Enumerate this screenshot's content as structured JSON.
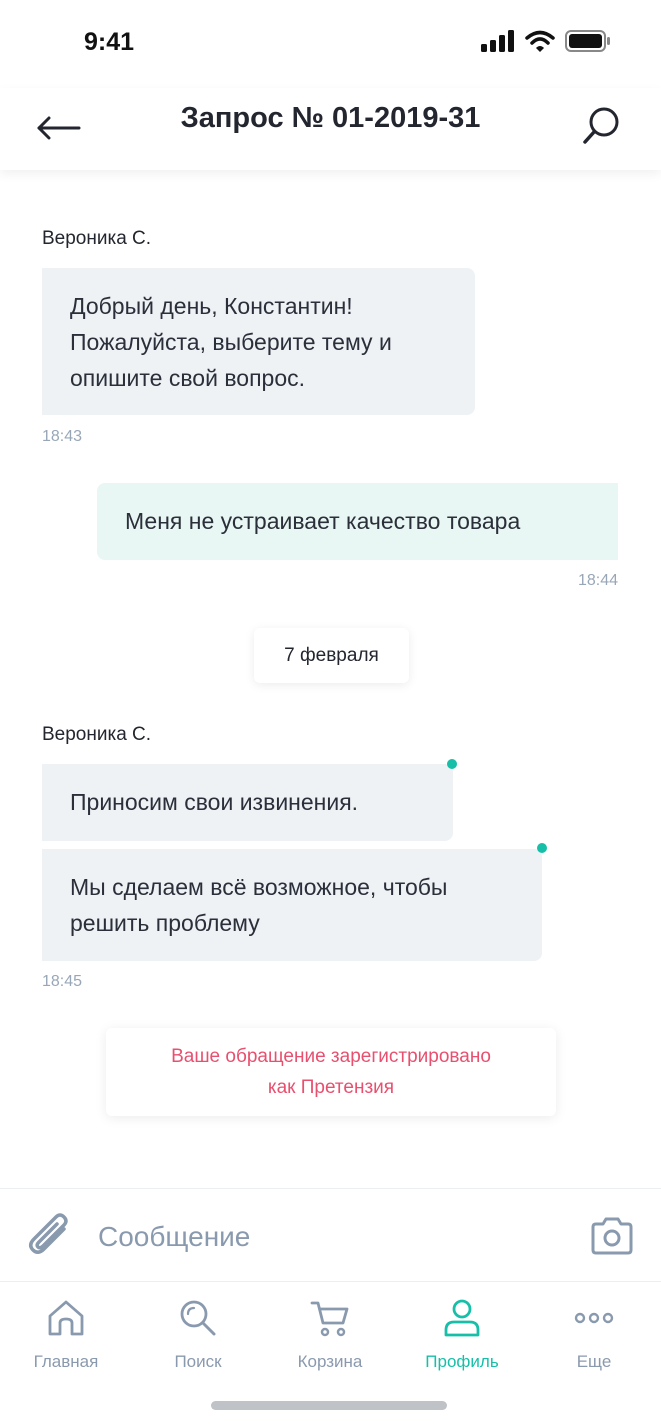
{
  "status_bar": {
    "time": "9:41"
  },
  "header": {
    "title": "Запрос № 01-2019-31",
    "back_icon": "arrow-left-icon",
    "search_icon": "search-icon"
  },
  "chat": {
    "msg1": {
      "sender": "Вероника С.",
      "lines": [
        "Добрый день, Константин!",
        "Пожалуйста, выберите тему и",
        "опишите свой вопрос."
      ],
      "time": "18:43"
    },
    "msg2": {
      "text": "Меня не устраивает качество товара",
      "time": "18:44"
    },
    "date_separator": "7 февраля",
    "msg3": {
      "sender": "Вероника С.",
      "text": "Приносим свои извинения."
    },
    "msg4": {
      "lines": [
        "Мы сделаем всё возможное, чтобы",
        "решить проблему"
      ],
      "time": "18:45"
    },
    "notice_lines": [
      "Ваше обращение зарегистрировано",
      "как Претензия"
    ]
  },
  "composer": {
    "placeholder": "Сообщение",
    "attach_icon": "paperclip-icon",
    "camera_icon": "camera-icon"
  },
  "tabbar": {
    "items": [
      {
        "label": "Главная",
        "icon": "home-icon"
      },
      {
        "label": "Поиск",
        "icon": "search-icon"
      },
      {
        "label": "Корзина",
        "icon": "cart-icon"
      },
      {
        "label": "Профиль",
        "icon": "profile-icon",
        "active": true
      },
      {
        "label": "Еще",
        "icon": "more-icon"
      }
    ]
  },
  "colors": {
    "accent": "#17bfa8",
    "incoming_bubble": "#eef2f5",
    "outgoing_bubble": "#e8f7f3",
    "notice_text": "#e8506f",
    "muted": "#8a9aae"
  }
}
